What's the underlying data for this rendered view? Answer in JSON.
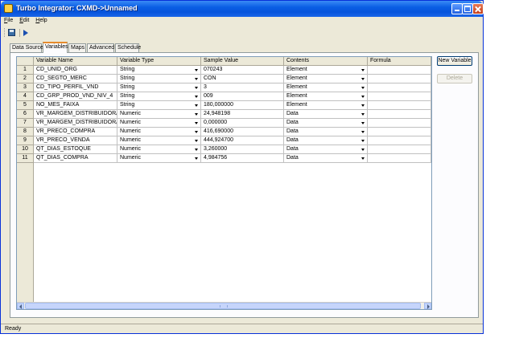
{
  "window": {
    "title": "Turbo Integrator:  CXMD->Unnamed"
  },
  "menu": [
    {
      "key": "F",
      "rest": "ile"
    },
    {
      "key": "E",
      "rest": "dit"
    },
    {
      "key": "H",
      "rest": "elp"
    }
  ],
  "tabs": [
    "Data Source",
    "Variables",
    "Maps",
    "Advanced",
    "Schedule"
  ],
  "active_tab": "Variables",
  "grid": {
    "columns": [
      "Variable Name",
      "Variable Type",
      "Sample Value",
      "Contents",
      "Formula"
    ],
    "rows": [
      {
        "num": "1",
        "name": "CD_UNID_ORG",
        "type": "String",
        "sample": "070243",
        "contents": "Element",
        "formula": ""
      },
      {
        "num": "2",
        "name": "CD_SEGTO_MERC",
        "type": "String",
        "sample": "CON",
        "contents": "Element",
        "formula": ""
      },
      {
        "num": "3",
        "name": "CD_TIPO_PERFIL_VND",
        "type": "String",
        "sample": "3",
        "contents": "Element",
        "formula": ""
      },
      {
        "num": "4",
        "name": "CD_GRP_PROD_VND_NIV_4",
        "type": "String",
        "sample": "009",
        "contents": "Element",
        "formula": ""
      },
      {
        "num": "5",
        "name": "NO_MES_FAIXA",
        "type": "String",
        "sample": "180,000000",
        "contents": "Element",
        "formula": ""
      },
      {
        "num": "6",
        "name": "VR_MARGEM_DISTRIBUIDORA",
        "type": "Numeric",
        "sample": "24,948198",
        "contents": "Data",
        "formula": ""
      },
      {
        "num": "7",
        "name": "VR_MARGEM_DISTRIBUIDORA_GN",
        "type": "Numeric",
        "sample": "0,000000",
        "contents": "Data",
        "formula": ""
      },
      {
        "num": "8",
        "name": "VR_PRECO_COMPRA",
        "type": "Numeric",
        "sample": "416,690000",
        "contents": "Data",
        "formula": ""
      },
      {
        "num": "9",
        "name": "VR_PRECO_VENDA",
        "type": "Numeric",
        "sample": "444,924700",
        "contents": "Data",
        "formula": ""
      },
      {
        "num": "10",
        "name": "QT_DIAS_ESTOQUE",
        "type": "Numeric",
        "sample": "3,260000",
        "contents": "Data",
        "formula": ""
      },
      {
        "num": "11",
        "name": "QT_DIAS_COMPRA",
        "type": "Numeric",
        "sample": "4,984756",
        "contents": "Data",
        "formula": ""
      }
    ]
  },
  "buttons": {
    "new_variable": "New Variable",
    "delete": "Delete"
  },
  "status": "Ready",
  "icons": {
    "save": "save-icon",
    "run": "run-icon"
  }
}
